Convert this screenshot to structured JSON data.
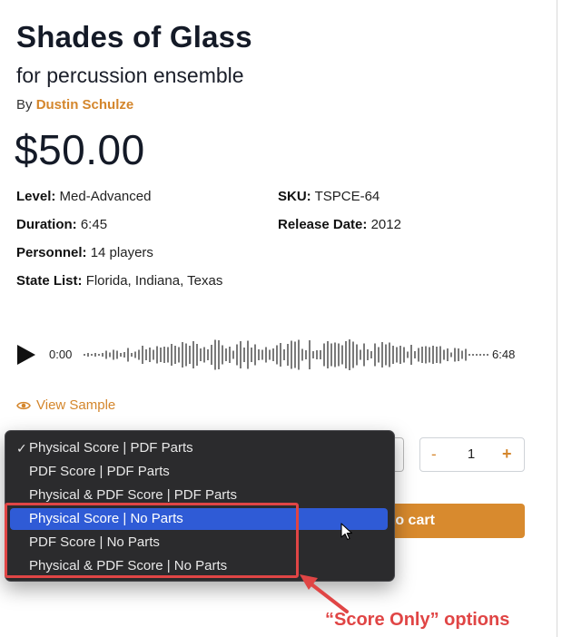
{
  "product": {
    "title": "Shades of Glass",
    "subtitle": "for percussion ensemble",
    "by_prefix": "By",
    "composer": "Dustin Schulze",
    "price": "$50.00"
  },
  "meta": {
    "level_label": "Level:",
    "level_value": "Med-Advanced",
    "sku_label": "SKU:",
    "sku_value": "TSPCE-64",
    "duration_label": "Duration:",
    "duration_value": "6:45",
    "release_label": "Release Date:",
    "release_value": "2012",
    "personnel_label": "Personnel:",
    "personnel_value": "14 players",
    "state_label": "State List:",
    "state_value": "Florida, Indiana, Texas"
  },
  "player": {
    "current_time": "0:00",
    "total_time": "6:48",
    "play_icon": "play-icon"
  },
  "view_sample": {
    "label": "View Sample",
    "icon": "eye-icon"
  },
  "quantity": {
    "minus": "-",
    "value": "1",
    "plus": "+"
  },
  "add_to_cart": {
    "visible_label": "to cart"
  },
  "dropdown": {
    "checkmark": "✓",
    "options": [
      {
        "label": "Physical Score | PDF Parts",
        "selected": true,
        "highlighted": false
      },
      {
        "label": "PDF Score | PDF Parts",
        "selected": false,
        "highlighted": false
      },
      {
        "label": "Physical & PDF Score | PDF Parts",
        "selected": false,
        "highlighted": false
      },
      {
        "label": "Physical Score | No Parts",
        "selected": false,
        "highlighted": true
      },
      {
        "label": "PDF Score | No Parts",
        "selected": false,
        "highlighted": false
      },
      {
        "label": "Physical & PDF Score | No Parts",
        "selected": false,
        "highlighted": false
      }
    ]
  },
  "annotation": {
    "text": "“Score Only” options"
  },
  "colors": {
    "accent": "#d88a2e",
    "link": "#d4862c",
    "annotation": "#e04545",
    "dropdown_bg": "#2b2b2d",
    "dropdown_highlight": "#2f5bd6"
  }
}
